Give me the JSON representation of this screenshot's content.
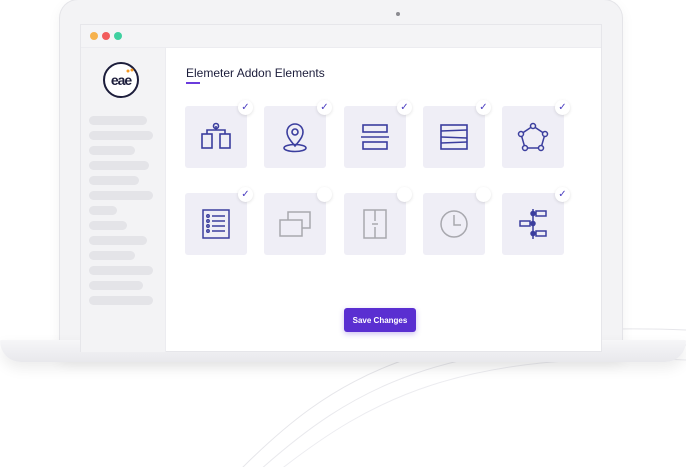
{
  "window": {
    "traffic_lights": [
      "#f6b24d",
      "#f25c5c",
      "#3fd0a0"
    ]
  },
  "sidebar": {
    "logo_text": "eae"
  },
  "main": {
    "title": "Elemeter Addon Elements",
    "save_label": "Save Changes",
    "accent": "#5a2fd1",
    "tiles": [
      {
        "icon": "product-comparison-icon",
        "checked": true
      },
      {
        "icon": "location-pin-icon",
        "checked": true
      },
      {
        "icon": "horizontal-split-icon",
        "checked": true
      },
      {
        "icon": "table-rows-icon",
        "checked": true
      },
      {
        "icon": "radial-nodes-icon",
        "checked": true
      },
      {
        "icon": "checklist-icon",
        "checked": true
      },
      {
        "icon": "layered-panels-icon",
        "checked": false
      },
      {
        "icon": "vertical-split-icon",
        "checked": false
      },
      {
        "icon": "clock-icon",
        "checked": false
      },
      {
        "icon": "timeline-icon",
        "checked": true
      }
    ]
  }
}
